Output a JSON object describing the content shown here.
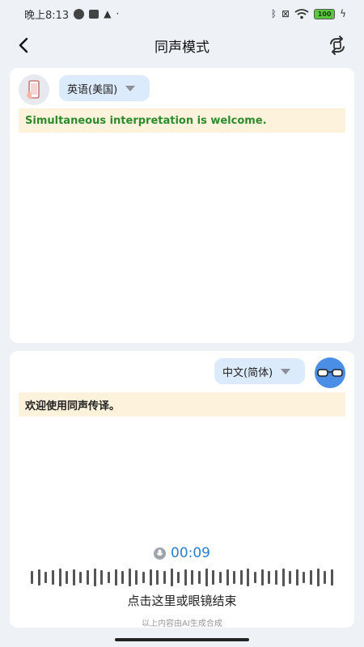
{
  "status_bar": {
    "time": "晚上8:13",
    "battery": "100",
    "icons": [
      "notification-icon",
      "square-icon",
      "warning-icon",
      "dot-icon",
      "bluetooth-icon",
      "sim-x-icon",
      "wifi-icon",
      "battery-icon",
      "charging-icon"
    ]
  },
  "header": {
    "title": "同声模式",
    "back_icon": "chevron-left-icon",
    "swap_icon": "swap-rotate-icon"
  },
  "top_panel": {
    "language": "英语(美国)",
    "avatar_icon": "phone-hand-icon",
    "text": "Simultaneous interpretation is welcome.",
    "text_color": "#2d8a2d"
  },
  "bottom_panel": {
    "language": "中文(简体)",
    "avatar_icon": "glasses-icon",
    "text": "欢迎使用同声传译。",
    "timer": "00:09",
    "timer_color": "#2a7fd0",
    "hint": "点击这里或眼镜结束",
    "ai_note": "以上内容由AI生成合成"
  },
  "colors": {
    "background": "#eef1f6",
    "lang_chip": "#dcebfb",
    "text_strip": "#fdf3dc",
    "accent_blue": "#4b8ee6"
  }
}
